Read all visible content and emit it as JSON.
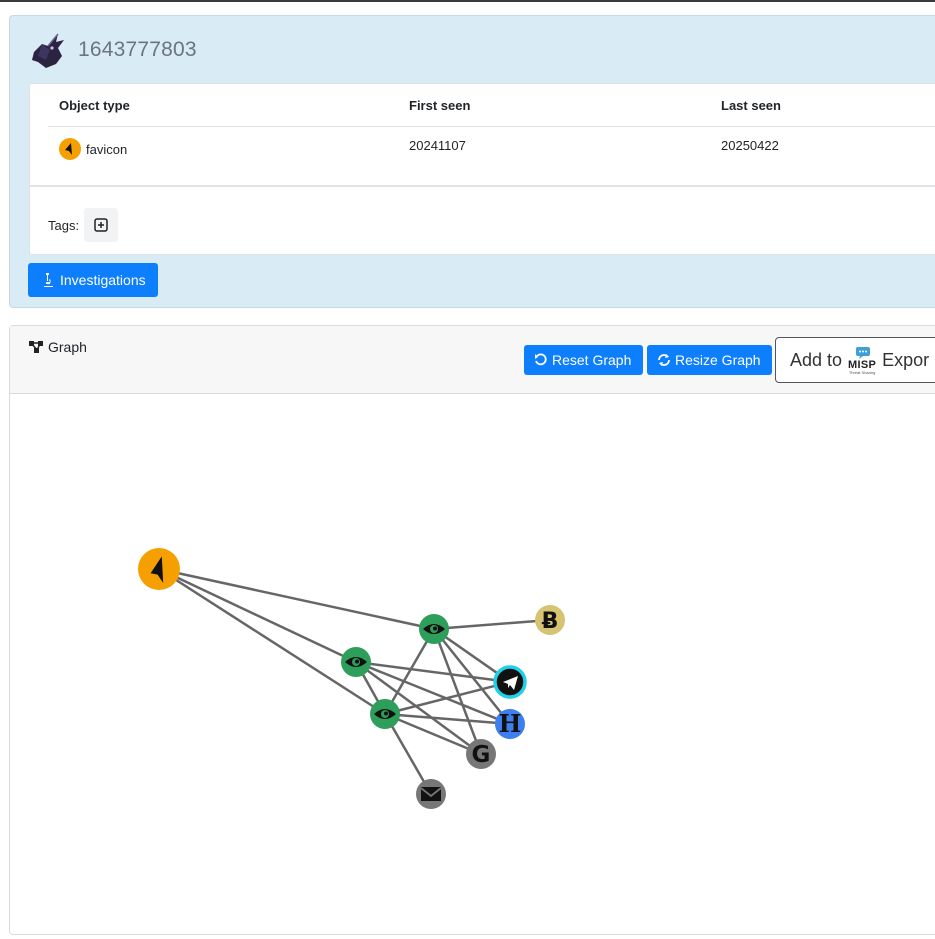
{
  "object": {
    "id_title": "1643777803",
    "columns": [
      "Object type",
      "First seen",
      "Last seen"
    ],
    "row": {
      "type": "favicon",
      "first_seen": "20241107",
      "last_seen": "20250422"
    },
    "tags_label": "Tags:",
    "investigations_label": "Investigations"
  },
  "graph": {
    "title": "Graph",
    "reset_label": "Reset Graph",
    "resize_label": "Resize Graph",
    "misp_add_label": "Add to",
    "misp_logo_text": "MISP",
    "misp_logo_sub": "Threat Sharing",
    "export_label": "Expor",
    "nodes": [
      {
        "id": "favicon",
        "icon": "favicon-icon",
        "color": "#f5a000"
      },
      {
        "id": "domain-1",
        "icon": "eye-icon",
        "color": "#2e9e5b"
      },
      {
        "id": "domain-2",
        "icon": "eye-icon",
        "color": "#2e9e5b"
      },
      {
        "id": "domain-3",
        "icon": "eye-icon",
        "color": "#2e9e5b"
      },
      {
        "id": "bitcoin",
        "icon": "bitcoin-icon",
        "color": "#d6c472"
      },
      {
        "id": "telegram",
        "icon": "telegram-icon",
        "color": "#1fd1e8"
      },
      {
        "id": "hash",
        "icon": "h-icon",
        "color": "#3d7ef0"
      },
      {
        "id": "google",
        "icon": "google-icon",
        "color": "#777777"
      },
      {
        "id": "email",
        "icon": "email-icon",
        "color": "#777777"
      }
    ],
    "edges": [
      [
        "favicon",
        "domain-1"
      ],
      [
        "favicon",
        "domain-2"
      ],
      [
        "favicon",
        "domain-3"
      ],
      [
        "domain-1",
        "bitcoin"
      ],
      [
        "domain-1",
        "telegram"
      ],
      [
        "domain-1",
        "hash"
      ],
      [
        "domain-1",
        "google"
      ],
      [
        "domain-1",
        "domain-3"
      ],
      [
        "domain-2",
        "telegram"
      ],
      [
        "domain-2",
        "hash"
      ],
      [
        "domain-2",
        "google"
      ],
      [
        "domain-2",
        "domain-3"
      ],
      [
        "domain-3",
        "telegram"
      ],
      [
        "domain-3",
        "hash"
      ],
      [
        "domain-3",
        "google"
      ],
      [
        "domain-3",
        "email"
      ]
    ]
  },
  "colors": {
    "accent": "#0d7efc",
    "card_bg": "#d9ebf5",
    "edge": "#666666"
  }
}
